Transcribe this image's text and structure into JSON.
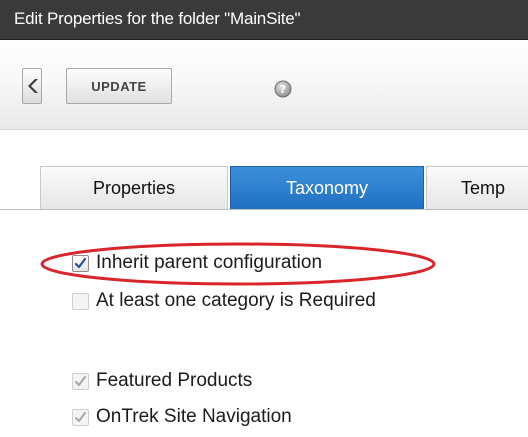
{
  "window": {
    "title": "Edit Properties for the folder \"MainSite\""
  },
  "toolbar": {
    "back_icon": "chevron-left-icon",
    "update_label": "UPDATE",
    "help_icon": "help-icon"
  },
  "tabs": [
    {
      "label": "Properties",
      "active": false
    },
    {
      "label": "Taxonomy",
      "active": true
    },
    {
      "label": "Temp",
      "active": false
    }
  ],
  "taxonomy": {
    "inherit_label": "Inherit parent configuration",
    "inherit_checked": true,
    "required_label": "At least one category is Required",
    "required_checked": false,
    "categories": [
      {
        "label": "Featured Products",
        "checked": true
      },
      {
        "label": "OnTrek Site Navigation",
        "checked": true
      }
    ]
  },
  "colors": {
    "title_bar": "#3a3a3a",
    "active_tab": "#2a7bcc",
    "highlight_ellipse": "#d9262c",
    "check_active": "#2b4fa0",
    "check_disabled": "#a6a6a6"
  }
}
